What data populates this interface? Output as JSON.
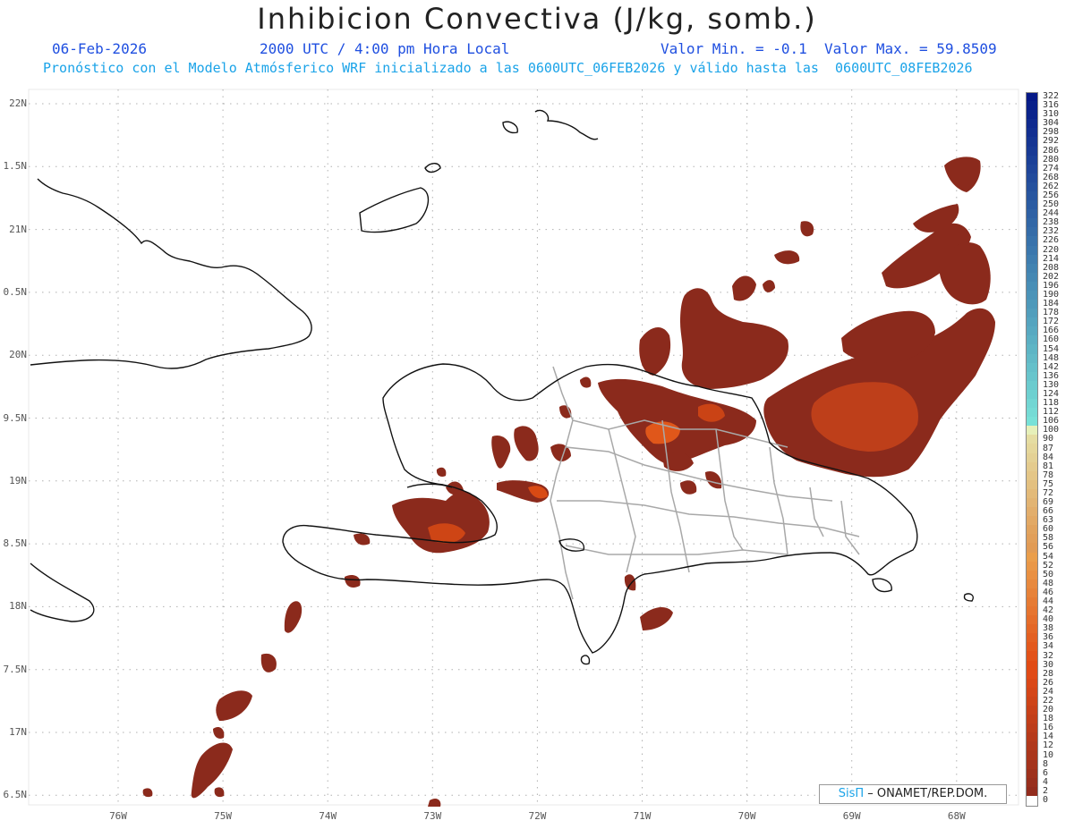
{
  "header": {
    "title": "Inhibicion Convectiva (J/kg, somb.)",
    "date": "06-Feb-2026",
    "time": "2000 UTC / 4:00 pm Hora Local",
    "range": "Valor Min. = -0.1  Valor Max. = 59.8509",
    "description": "Pronóstico con el Modelo Atmósferico WRF inicializado a las 0600UTC_06FEB2026 y válido hasta las  0600UTC_08FEB2026"
  },
  "map": {
    "lat_labels": [
      "22N",
      "1.5N",
      "21N",
      "0.5N",
      "20N",
      "9.5N",
      "19N",
      "8.5N",
      "18N",
      "7.5N",
      "17N",
      "6.5N"
    ],
    "lon_labels": [
      "76W",
      "75W",
      "74W",
      "73W",
      "72W",
      "71W",
      "70W",
      "69W",
      "68W"
    ]
  },
  "colorbar": {
    "labels": [
      "322",
      "316",
      "310",
      "304",
      "298",
      "292",
      "286",
      "280",
      "274",
      "268",
      "262",
      "256",
      "250",
      "244",
      "238",
      "232",
      "226",
      "220",
      "214",
      "208",
      "202",
      "196",
      "190",
      "184",
      "178",
      "172",
      "166",
      "160",
      "154",
      "148",
      "142",
      "136",
      "130",
      "124",
      "118",
      "112",
      "106",
      "100",
      "90",
      "87",
      "84",
      "81",
      "78",
      "75",
      "72",
      "69",
      "66",
      "63",
      "60",
      "58",
      "56",
      "54",
      "52",
      "50",
      "48",
      "46",
      "44",
      "42",
      "40",
      "38",
      "36",
      "34",
      "32",
      "30",
      "28",
      "26",
      "24",
      "22",
      "20",
      "18",
      "16",
      "14",
      "12",
      "10",
      "8",
      "6",
      "4",
      "2",
      "0"
    ]
  },
  "colors": {
    "shading_main": "#8b2a1c",
    "shading_high": "#d94a14",
    "shading_peak": "#f06a1a",
    "coast": "#000000",
    "borders": "#a8a8a8"
  },
  "credit": {
    "brand": "SisΠ",
    "text": "– ONAMET/REP.DOM."
  }
}
